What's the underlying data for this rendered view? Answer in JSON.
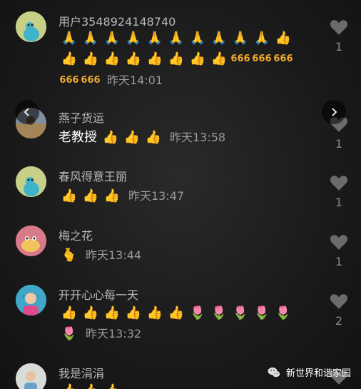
{
  "comments": [
    {
      "username": "用户3548924148740",
      "prefix": "",
      "emojis": [
        "🙏",
        "🙏",
        "🙏",
        "🙏",
        "🙏",
        "🙏",
        "🙏",
        "🙏",
        "🙏",
        "🙏",
        "👍",
        "👍",
        "👍",
        "👍",
        "👍",
        "👍",
        "👍",
        "👍",
        "👍",
        "666",
        "666",
        "666",
        "666",
        "666"
      ],
      "time": "昨天14:01",
      "likes": "1"
    },
    {
      "username": "燕子货运",
      "prefix": "老教授",
      "emojis": [
        "👍",
        "👍",
        "👍"
      ],
      "time": "昨天13:58",
      "likes": "1"
    },
    {
      "username": "春风得意王丽",
      "prefix": "",
      "emojis": [
        "👍",
        "👍",
        "👍"
      ],
      "time": "昨天13:47",
      "likes": "1"
    },
    {
      "username": "梅之花",
      "prefix": "",
      "emojis": [
        "🫰"
      ],
      "time": "昨天13:44",
      "likes": "1"
    },
    {
      "username": "开开心心每一天",
      "prefix": "",
      "emojis": [
        "👍",
        "👍",
        "👍",
        "👍",
        "👍",
        "👍",
        "🌷",
        "🌷",
        "🌷",
        "🌷",
        "🌷",
        "🌷"
      ],
      "time": "昨天13:32",
      "likes": "2"
    },
    {
      "username": "我是涓涓",
      "prefix": "",
      "emojis": [
        "👍",
        "👍",
        "👍"
      ],
      "time": "",
      "likes": ""
    }
  ],
  "watermark": "新世界和谐家园",
  "icons": {
    "like": "heart-icon",
    "prev": "chevron-left-icon",
    "next": "chevron-right-icon",
    "watermark": "wechat-icon"
  }
}
